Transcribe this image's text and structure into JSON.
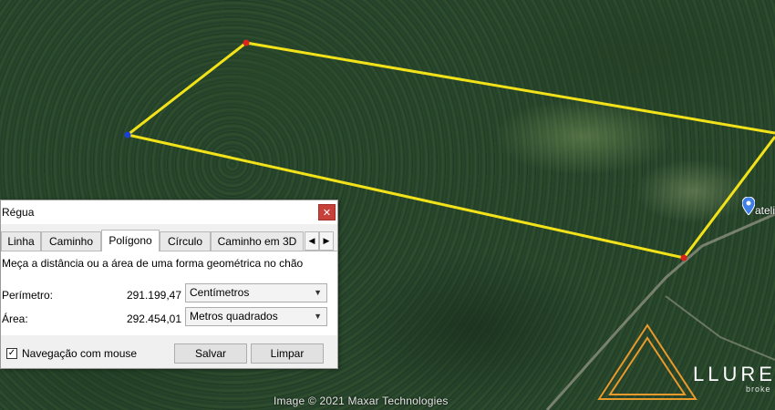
{
  "map": {
    "attribution": "Image © 2021 Maxar Technologies",
    "place_label": "ateli",
    "brand_name": "LLURE",
    "brand_sub": "broke"
  },
  "dialog": {
    "title": "Régua",
    "tabs": [
      {
        "label": "Linha"
      },
      {
        "label": "Caminho"
      },
      {
        "label": "Polígono",
        "active": true
      },
      {
        "label": "Círculo"
      },
      {
        "label": "Caminho em 3D"
      }
    ],
    "description": "Meça a distância ou a área de uma forma geométrica no chão",
    "perimeter": {
      "label": "Perímetro:",
      "value": "291.199,47",
      "unit": "Centímetros"
    },
    "area": {
      "label": "Área:",
      "value": "292.454,01",
      "unit": "Metros quadrados"
    },
    "mouse_nav": {
      "label": "Navegação com mouse",
      "checked": true
    },
    "save_label": "Salvar",
    "clear_label": "Limpar"
  },
  "colors": {
    "polygon_line": "#f2e21a",
    "vertex_red": "#d8241c",
    "vertex_blue": "#1c3fd8",
    "close_red": "#c8403a",
    "brand_orange": "#e89a2c"
  }
}
